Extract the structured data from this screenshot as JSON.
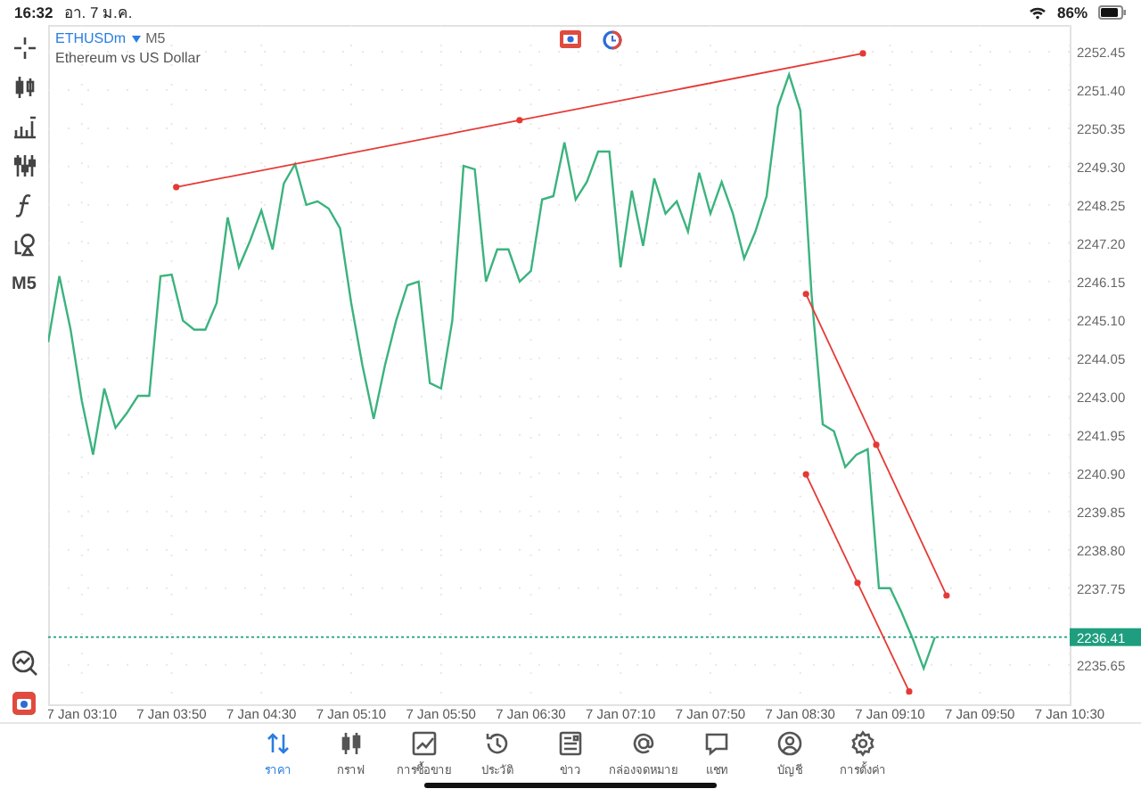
{
  "status_bar": {
    "time": "16:32",
    "date": "อา. 7 ม.ค.",
    "battery": "86%"
  },
  "toolbar": {
    "timeframe": "M5"
  },
  "header": {
    "symbol": "ETHUSDm",
    "timeframe": "M5",
    "description": "Ethereum vs US Dollar"
  },
  "chart": {
    "chart_data": {
      "type": "line",
      "grid": true,
      "ylim": [
        2234.57,
        2253.18
      ],
      "categories": [
        null,
        null,
        null,
        "7 Jan 03:10",
        null,
        null,
        null,
        null,
        null,
        null,
        null,
        "7 Jan 03:50",
        null,
        null,
        null,
        null,
        null,
        null,
        null,
        "7 Jan 04:30",
        null,
        null,
        null,
        null,
        null,
        null,
        null,
        "7 Jan 05:10",
        null,
        null,
        null,
        null,
        null,
        null,
        null,
        "7 Jan 05:50",
        null,
        null,
        null,
        null,
        null,
        null,
        null,
        "7 Jan 06:30",
        null,
        null,
        null,
        null,
        null,
        null,
        null,
        "7 Jan 07:10",
        null,
        null,
        null,
        null,
        null,
        null,
        null,
        "7 Jan 07:50",
        null,
        null,
        null,
        null,
        null,
        null,
        null,
        "7 Jan 08:30",
        null,
        null,
        null,
        null,
        null,
        null,
        null,
        "7 Jan 09:10",
        null,
        null,
        null,
        null,
        null,
        null,
        null,
        "7 Jan 09:50",
        null,
        null,
        null,
        null,
        null,
        null,
        null,
        "7 Jan 10:30"
      ],
      "yticks": [
        {
          "value": 2252.45,
          "label": "2252.45"
        },
        {
          "value": 2251.4,
          "label": "2251.40"
        },
        {
          "value": 2250.35,
          "label": "2250.35"
        },
        {
          "value": 2249.3,
          "label": "2249.30"
        },
        {
          "value": 2248.25,
          "label": "2248.25"
        },
        {
          "value": 2247.2,
          "label": "2247.20"
        },
        {
          "value": 2246.15,
          "label": "2246.15"
        },
        {
          "value": 2245.1,
          "label": "2245.10"
        },
        {
          "value": 2244.05,
          "label": "2244.05"
        },
        {
          "value": 2243.0,
          "label": "2243.00"
        },
        {
          "value": 2241.95,
          "label": "2241.95"
        },
        {
          "value": 2240.9,
          "label": "2240.90"
        },
        {
          "value": 2239.85,
          "label": "2239.85"
        },
        {
          "value": 2238.8,
          "label": "2238.80"
        },
        {
          "value": 2237.75,
          "label": "2237.75"
        },
        {
          "value": 2235.65,
          "label": "2235.65"
        }
      ],
      "series": [
        {
          "color": "#3bb37e",
          "values": [
            2244.49,
            2246.3,
            2244.83,
            2242.88,
            2241.41,
            2243.22,
            2242.14,
            2242.54,
            2243.02,
            2243.02,
            2246.3,
            2246.34,
            2245.08,
            2244.83,
            2244.83,
            2245.56,
            2247.91,
            2246.54,
            2247.27,
            2248.1,
            2247.03,
            2248.84,
            2249.37,
            2248.25,
            2248.35,
            2248.15,
            2247.61,
            2245.56,
            2243.85,
            2242.39,
            2243.85,
            2245.08,
            2246.05,
            2246.15,
            2243.37,
            2243.22,
            2245.08,
            2249.32,
            2249.23,
            2246.15,
            2247.03,
            2247.03,
            2246.15,
            2246.44,
            2248.4,
            2248.49,
            2249.96,
            2248.4,
            2248.88,
            2249.71,
            2249.71,
            2246.54,
            2248.64,
            2247.13,
            2248.98,
            2248.01,
            2248.35,
            2247.52,
            2249.13,
            2248.01,
            2248.88,
            2248.01,
            2246.78,
            2247.52,
            2248.49,
            2250.94,
            2251.82,
            2250.84,
            2245.81,
            2242.24,
            2242.05,
            2241.07,
            2241.41,
            2241.56,
            2237.75,
            2237.75,
            2237.11,
            2236.38,
            2235.55,
            2236.41,
            null,
            null,
            null,
            null,
            null,
            null,
            null,
            null,
            null,
            null,
            null,
            null
          ]
        }
      ],
      "ref_lines": [
        {
          "axis": "y",
          "value": 2236.41,
          "label": "2236.41"
        }
      ]
    }
  },
  "tabs": [
    {
      "label": "ราคา",
      "selected": true
    },
    {
      "label": "กราฟ",
      "selected": false
    },
    {
      "label": "การซื้อขาย",
      "selected": false
    },
    {
      "label": "ประวัติ",
      "selected": false
    },
    {
      "label": "ข่าว",
      "selected": false
    },
    {
      "label": "กล่องจดหมาย",
      "selected": false
    },
    {
      "label": "แชท",
      "selected": false
    },
    {
      "label": "บัญชี",
      "selected": false
    },
    {
      "label": "การตั้งค่า",
      "selected": false
    }
  ]
}
